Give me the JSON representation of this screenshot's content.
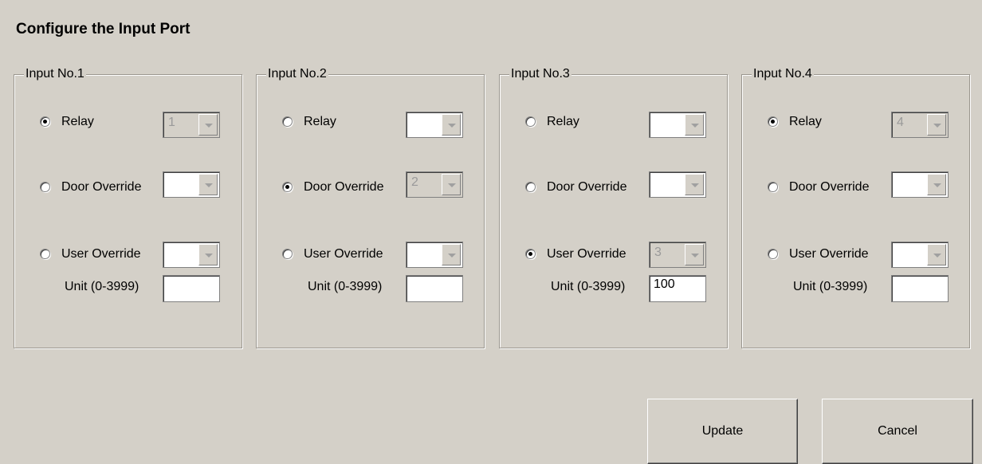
{
  "title": "Configure the Input Port",
  "groups": [
    {
      "legend": "Input No.1",
      "relay_label": "Relay",
      "door_label": "Door Override",
      "user_label": "User Override",
      "unit_label": "Unit (0-3999)",
      "selected": "relay",
      "relay_value": "1",
      "door_value": "",
      "user_value": "",
      "unit_value": ""
    },
    {
      "legend": "Input No.2",
      "relay_label": "Relay",
      "door_label": "Door Override",
      "user_label": "User Override",
      "unit_label": "Unit (0-3999)",
      "selected": "door",
      "relay_value": "",
      "door_value": "2",
      "user_value": "",
      "unit_value": ""
    },
    {
      "legend": "Input No.3",
      "relay_label": "Relay",
      "door_label": "Door Override",
      "user_label": "User Override",
      "unit_label": "Unit (0-3999)",
      "selected": "user",
      "relay_value": "",
      "door_value": "",
      "user_value": "3",
      "unit_value": "100"
    },
    {
      "legend": "Input No.4",
      "relay_label": "Relay",
      "door_label": "Door Override",
      "user_label": "User Override",
      "unit_label": "Unit (0-3999)",
      "selected": "relay",
      "relay_value": "4",
      "door_value": "",
      "user_value": "",
      "unit_value": ""
    }
  ],
  "buttons": {
    "update": "Update",
    "cancel": "Cancel"
  }
}
